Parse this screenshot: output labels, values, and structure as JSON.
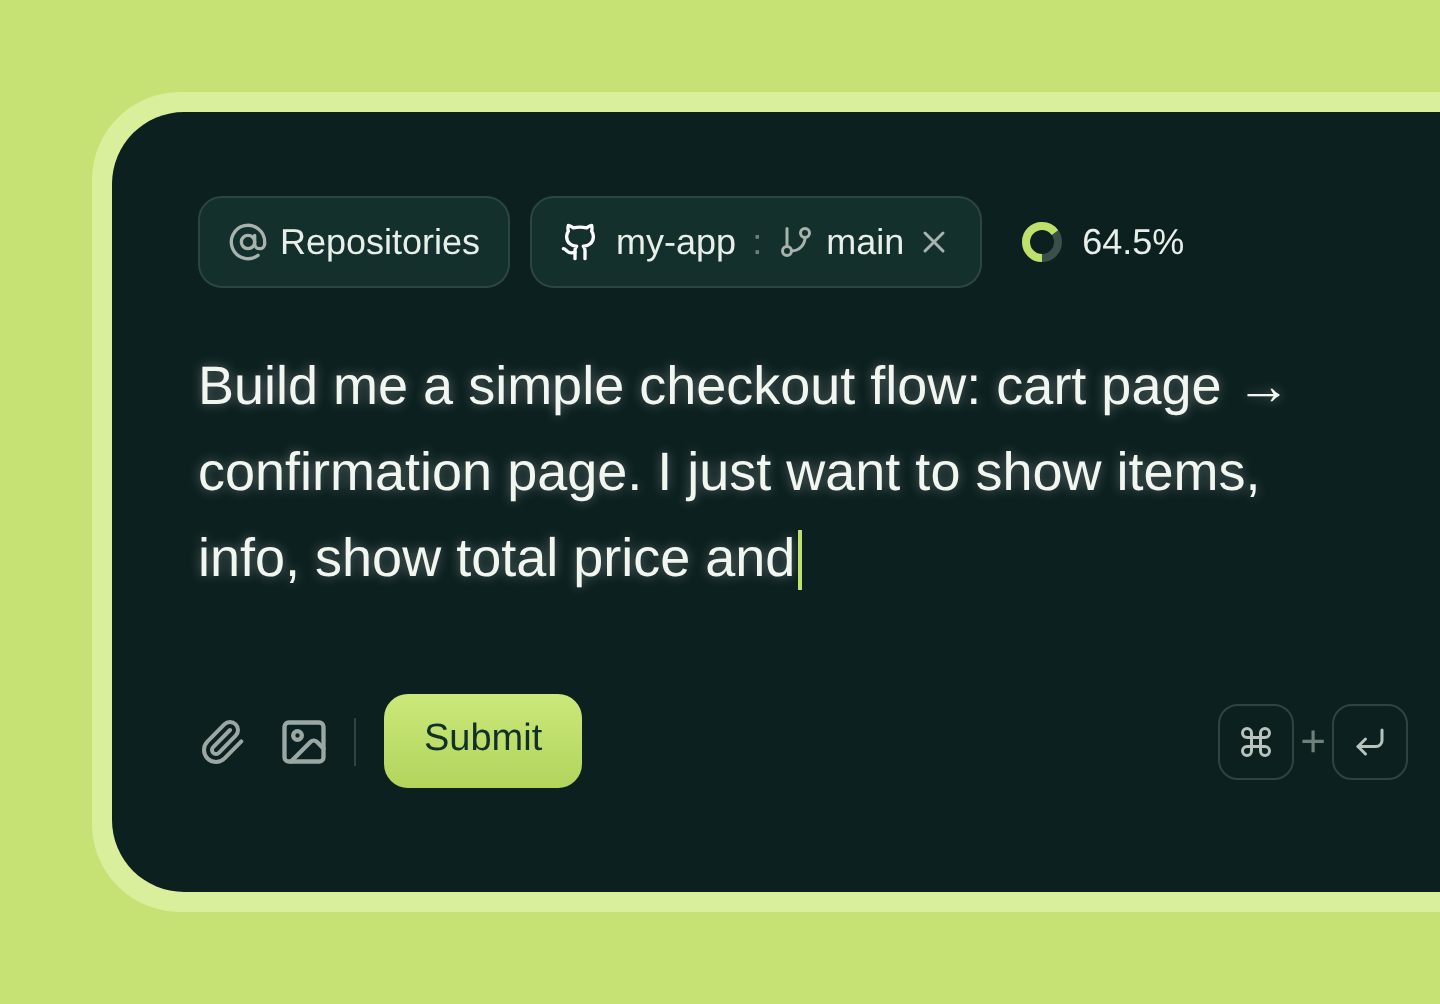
{
  "context_chips": [
    {
      "kind": "mention",
      "label": "Repositories"
    },
    {
      "kind": "repo",
      "label": "my-app",
      "separator": ":",
      "branch": "main"
    }
  ],
  "usage": {
    "level": 0.645,
    "reading": "64.5%"
  },
  "prompt_lines": [
    "Build me a simple checkout flow: cart page →",
    "confirmation page. I just want to show items,",
    "info, show total price and"
  ],
  "submit_label": "Submit",
  "shortcut": {
    "plus": "+"
  }
}
